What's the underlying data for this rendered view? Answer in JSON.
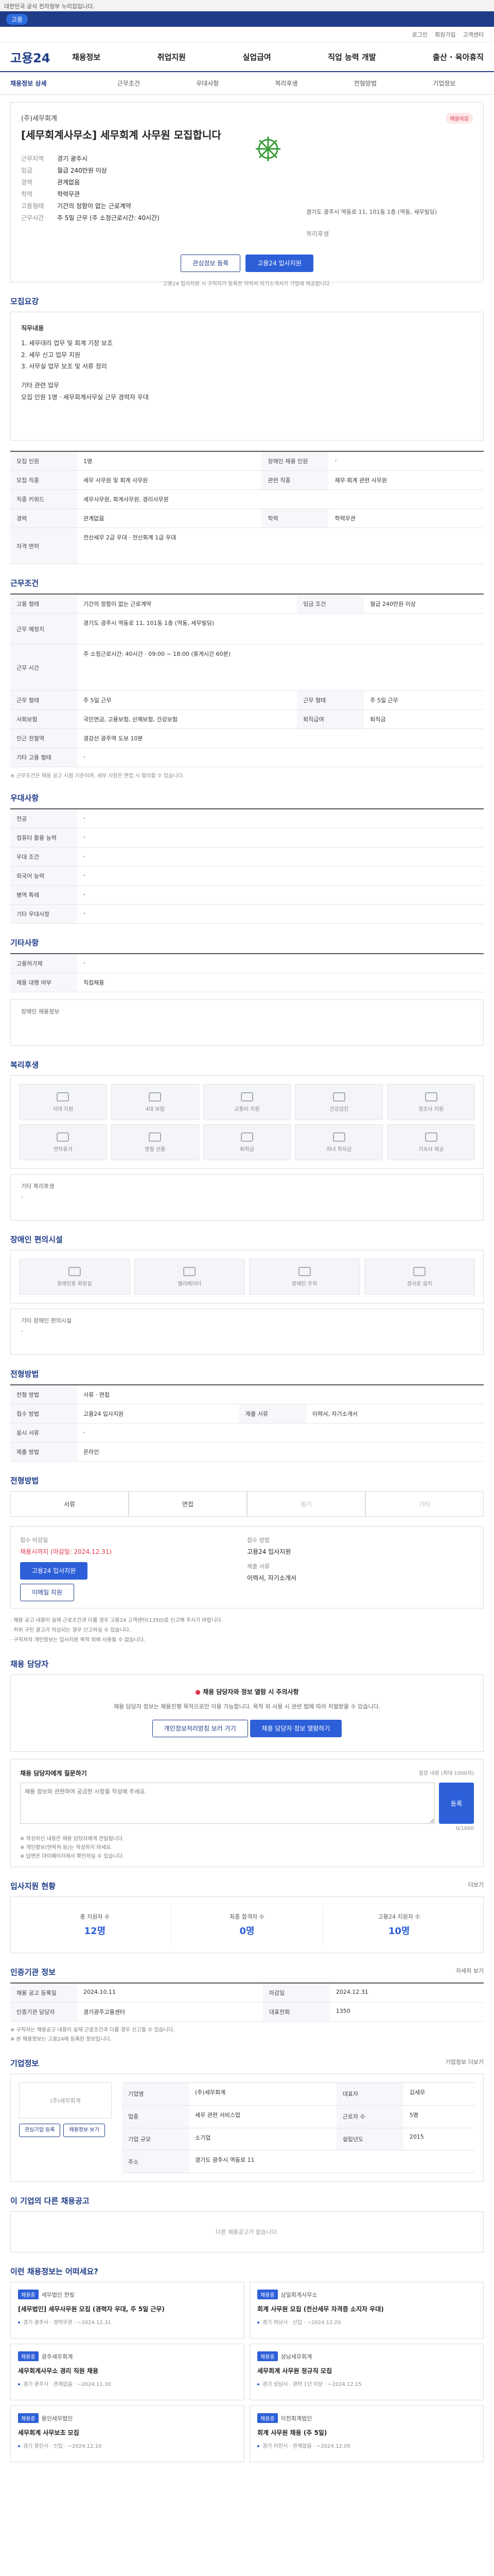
{
  "topbar": {
    "text": "대한민국 공식 전자정부 누리집입니다."
  },
  "banner": {
    "chip": "고용",
    "text": ""
  },
  "util": [
    "로그인",
    "회원가입",
    "고객센터"
  ],
  "header": {
    "logo": "고용24",
    "menu": [
      "채용정보",
      "취업지원",
      "실업급여",
      "직업 능력 개발",
      "출산 · 육아휴직"
    ]
  },
  "lnb": [
    "채용정보 상세",
    "근무조건",
    "우대사항",
    "복리후생",
    "전형방법",
    "기업정보"
  ],
  "summary": {
    "section": "채용정보 상세",
    "badge": "채용마감",
    "company": "(주)세무회계",
    "title": "[세무회계사무소] 세무회계 사무원 모집합니다",
    "labels": {
      "region": "근무지역",
      "salary": "임금",
      "career": "경력",
      "edu": "학력",
      "type": "고용형태",
      "time": "근무시간",
      "welfare": "복리후생"
    },
    "values": {
      "region": "경기 광주시",
      "salary": "월급 240만원 이상",
      "career": "관계없음",
      "edu": "학력무관",
      "type": "기간의 정함이 없는 근로계약",
      "time": "주 5일 근무 (주 소정근로시간: 40시간)",
      "address": "경기도 광주시 역동로 11, 101동 1층 (역동, 세무빌딩)"
    },
    "btn_scrap": "관심정보 등록",
    "btn_apply": "고용24 입사지원",
    "note": "고용24 입사지원 시 구직자가 등록한 이력서·자기소개서가 기업에 제공됩니다."
  },
  "job_desc": {
    "title": "모집요강",
    "header": "직무내용",
    "lines": [
      "1. 세무대리 업무 및 회계 기장 보조",
      "2. 세무 신고 업무 지원",
      "3. 사무실 업무 보조 및 서류 정리",
      "",
      "기타 관련 업무",
      "모집 인원 1명 · 세무회계사무실 근무 경력자 우대"
    ]
  },
  "recruit_table": {
    "rows": [
      {
        "k1": "모집 인원",
        "v1": "1명",
        "k2": "장애인 채용 인원",
        "v2": "-"
      },
      {
        "k1": "모집 직종",
        "v1": "세무 사무원 및 회계 사무원",
        "k2": "관련 직종",
        "v2": "재무·회계 관련 사무원"
      },
      {
        "k1": "직종 키워드",
        "v1": "세무사무원, 회계사무원, 경리사무원",
        "k2": "",
        "v2": ""
      },
      {
        "k1": "경력",
        "v1": "관계없음",
        "k2": "학력",
        "v2": "학력무관"
      },
      {
        "k1": "자격 면허",
        "v1": "전산세무 2급 우대 · 전산회계 1급 우대",
        "k2": "",
        "v2": ""
      }
    ]
  },
  "work_cond": {
    "title": "근무조건",
    "rows": [
      {
        "k1": "고용 형태",
        "v1": "기간의 정함이 없는 근로계약",
        "k2": "임금 조건",
        "v2": "월급 240만원 이상"
      },
      {
        "k1": "근무 예정지",
        "v1": "경기도 광주시 역동로 11, 101동 1층 (역동, 세무빌딩)",
        "k2": "",
        "v2": ""
      },
      {
        "k1": "근무 시간",
        "v1": "주 소정근로시간: 40시간 · 09:00 ~ 18:00 (휴게시간 60분)",
        "k2": "",
        "v2": ""
      },
      {
        "k1": "근무 형태",
        "v1": "주 5일 근무",
        "k2": "근무 형태",
        "v2": "주 5일 근무"
      },
      {
        "k1": "사회보험",
        "v1": "국민연금, 고용보험, 산재보험, 건강보험",
        "k2": "퇴직급여",
        "v2": "퇴직금"
      },
      {
        "k1": "인근 전철역",
        "v1": "경강선 광주역 도보 10분",
        "k2": "",
        "v2": ""
      },
      {
        "k1": "기타 고용 형태",
        "v1": "-",
        "k2": "",
        "v2": ""
      }
    ],
    "note": "※ 근무조건은 채용 공고 시점 기준이며, 세부 사항은 면접 시 협의할 수 있습니다."
  },
  "prefer": {
    "title": "우대사항",
    "rows": [
      {
        "k": "전공",
        "v": "-"
      },
      {
        "k": "컴퓨터 활용 능력",
        "v": "-"
      },
      {
        "k": "우대 조건",
        "v": "-"
      },
      {
        "k": "외국어 능력",
        "v": "-"
      },
      {
        "k": "병역 특례",
        "v": "-"
      },
      {
        "k": "기타 우대사항",
        "v": "-"
      }
    ]
  },
  "etc": {
    "title": "기타사항",
    "rows": [
      {
        "k": "고용허가제",
        "v": "-"
      },
      {
        "k": "채용 대행 여부",
        "v": "직접채용"
      }
    ],
    "btn": "장애인 채용정보"
  },
  "welfare": {
    "title": "복리후생",
    "items": [
      "식대 지원",
      "4대 보험",
      "교통비 지원",
      "건강검진",
      "경조사 지원",
      "연차휴가",
      "명절 선물",
      "퇴직금",
      "자녀 학자금",
      "기숙사 제공"
    ],
    "other_label": "기타 복리후생",
    "other_value": "-"
  },
  "disabled": {
    "title": "장애인 편의시설",
    "items": [
      "장애인용 화장실",
      "엘리베이터",
      "장애인 주차",
      "경사로 설치"
    ],
    "other_label": "기타 장애인 편의시설",
    "other_value": "-"
  },
  "process": {
    "title": "전형방법",
    "rows": [
      {
        "k1": "전형 방법",
        "v1": "서류 · 면접",
        "k2": "",
        "v2": ""
      },
      {
        "k1": "접수 방법",
        "v1": "고용24 입사지원",
        "k2": "제출 서류",
        "v2": "이력서, 자기소개서"
      },
      {
        "k1": "응시 서류",
        "v1": "-",
        "k2": "",
        "v2": ""
      },
      {
        "k1": "제출 방법",
        "v1": "온라인",
        "k2": "",
        "v2": ""
      }
    ]
  },
  "apply_method": {
    "title": "전형방법",
    "opts": [
      "서류",
      "면접",
      "필기",
      "기타"
    ]
  },
  "contact": {
    "label_deadline": "접수 마감일",
    "deadline": "채용시까지 (마감일: 2024.12.31)",
    "label_method": "접수 방법",
    "method": "고용24 입사지원",
    "label_doc": "제출 서류",
    "doc": "이력서, 자기소개서",
    "btn_apply": "고용24 입사지원",
    "btn_email": "이메일 지원"
  },
  "warning": {
    "lines": [
      "· 채용 공고 내용이 실제 근로조건과 다를 경우 고용24 고객센터(1350)로 신고해 주시기 바랍니다.",
      "· 허위 구인 광고가 의심되는 경우 신고하실 수 있습니다.",
      "· 구직자의 개인정보는 입사지원 목적 외에 사용될 수 없습니다."
    ]
  },
  "manager": {
    "title": "채용 담당자",
    "alert": "채용 담당자와 정보 열람 시 주의사항",
    "alert_sub": "채용 담당자 정보는 채용진행 목적으로만 이용 가능합니다. 목적 외 사용 시 관련 법에 따라 처벌받을 수 있습니다.",
    "btn_1": "개인정보처리방침 보러 가기",
    "btn_2": "채용 담당자 정보 열람하기"
  },
  "inquiry": {
    "title": "채용 담당자에게 질문하기",
    "hint": "질문 내용 (최대 1000자)",
    "placeholder": "채용 정보와 관련하여 궁금한 사항을 작성해 주세요.",
    "counter": "0/1000",
    "btn": "등록",
    "notes": [
      "※ 작성하신 내용은 채용 담당자에게 전달됩니다.",
      "※ 개인정보(연락처 등)는 작성하지 마세요.",
      "※ 답변은 마이페이지에서 확인하실 수 있습니다."
    ]
  },
  "stats": {
    "title": "입사지원 현황",
    "more": "더보기",
    "cells": [
      {
        "label": "총 지원자 수",
        "value": "12명"
      },
      {
        "label": "최종 합격자 수",
        "value": "0명"
      },
      {
        "label": "고용24 지원자 수",
        "value": "10명"
      }
    ]
  },
  "info": {
    "title": "인증기관 정보",
    "more": "자세히 보기",
    "rows": [
      {
        "k1": "채용 공고 등록일",
        "v1": "2024.10.11",
        "k2": "마감일",
        "v2": "2024.12.31"
      },
      {
        "k1": "인증기관 담당자",
        "v1": "경기광주고용센터",
        "k2": "대표전화",
        "v2": "1350"
      }
    ],
    "notes": [
      "※ 구직자는 채용공고 내용이 실제 근로조건과 다를 경우 신고할 수 있습니다.",
      "※ 본 채용정보는 고용24에 등록된 정보입니다."
    ]
  },
  "company_info": {
    "title": "기업정보",
    "more": "기업정보 더보기",
    "logo_text": "(주)세무회계",
    "rows": [
      {
        "k1": "기업명",
        "v1": "(주)세무회계",
        "k2": "대표자",
        "v2": "김세무"
      },
      {
        "k1": "업종",
        "v1": "세무 관련 서비스업",
        "k2": "근로자 수",
        "v2": "5명"
      },
      {
        "k1": "기업 규모",
        "v1": "소기업",
        "k2": "설립년도",
        "v2": "2015"
      },
      {
        "k1": "주소",
        "v1": "경기도 광주시 역동로 11",
        "k2": "",
        "v2": ""
      }
    ],
    "btn_1": "관심기업 등록",
    "btn_2": "채용정보 보기"
  },
  "other_jobs": {
    "title": "이 기업의 다른 채용공고",
    "empty": "다른 채용공고가 없습니다."
  },
  "recommend": {
    "title": "이런 채용정보는 어떠세요?",
    "cards": [
      {
        "tag": "채용중",
        "company": "세무법인 한빛",
        "title": "[세무법인] 세무사무원 모집 (경력자 우대, 주 5일 근무)",
        "meta": "경기 광주시 · 경력무관",
        "date": "~2024.12.31"
      },
      {
        "tag": "채용중",
        "company": "삼일회계사무소",
        "title": "회계 사무원 모집 (전산세무 자격증 소지자 우대)",
        "meta": "경기 하남시 · 신입",
        "date": "~2024.12.20"
      },
      {
        "tag": "채용중",
        "company": "광주세무회계",
        "title": "세무회계사무소 경리 직원 채용",
        "meta": "경기 광주시 · 관계없음",
        "date": "~2024.11.30"
      },
      {
        "tag": "채용중",
        "company": "성남세무회계",
        "title": "세무회계 사무원 정규직 모집",
        "meta": "경기 성남시 · 경력 1년 이상",
        "date": "~2024.12.15"
      },
      {
        "tag": "채용중",
        "company": "용인세무법인",
        "title": "세무회계 사무보조 모집",
        "meta": "경기 용인시 · 신입",
        "date": "~2024.12.10"
      },
      {
        "tag": "채용중",
        "company": "이천회계법인",
        "title": "회계 사무원 채용 (주 5일)",
        "meta": "경기 이천시 · 관계없음",
        "date": "~2024.12.05"
      }
    ]
  },
  "colors": {
    "primary": "#1f3c88",
    "accent": "#2d5fd8",
    "danger": "#e0344f"
  }
}
